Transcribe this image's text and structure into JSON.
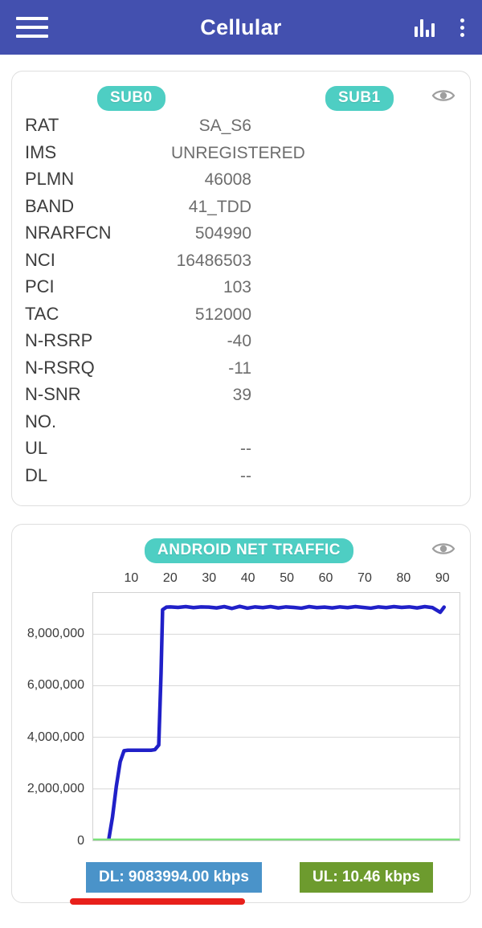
{
  "appbar": {
    "title": "Cellular",
    "menu_icon": "hamburger-menu-icon",
    "chart_icon": "bar-chart-icon",
    "overflow_icon": "more-vertical-icon"
  },
  "info_card": {
    "sub0_label": "SUB0",
    "sub1_label": "SUB1",
    "eye_icon": "eye-icon",
    "rows": [
      {
        "key": "RAT",
        "value": "SA_S6"
      },
      {
        "key": "IMS",
        "value": "UNREGISTERED"
      },
      {
        "key": "PLMN",
        "value": "46008"
      },
      {
        "key": "BAND",
        "value": "41_TDD"
      },
      {
        "key": "NRARFCN",
        "value": "504990"
      },
      {
        "key": "NCI",
        "value": "16486503"
      },
      {
        "key": "PCI",
        "value": "103"
      },
      {
        "key": "TAC",
        "value": "512000"
      },
      {
        "key": "N-RSRP",
        "value": "-40"
      },
      {
        "key": "N-RSRQ",
        "value": "-11"
      },
      {
        "key": "N-SNR",
        "value": "39"
      },
      {
        "key": "NO.",
        "value": ""
      },
      {
        "key": "UL",
        "value": "--"
      },
      {
        "key": "DL",
        "value": "--"
      }
    ]
  },
  "chart_card": {
    "title": "ANDROID NET TRAFFIC",
    "eye_icon": "eye-icon",
    "dl_label": "DL: 9083994.00 kbps",
    "ul_label": "UL: 10.46 kbps"
  },
  "colors": {
    "appbar": "#4350af",
    "badge_teal": "#4ecec3",
    "dl_blue": "#4a93c9",
    "ul_green": "#6d9b2e",
    "line_download": "#2020c8",
    "line_upload": "#7ae07a",
    "annotation_red": "#e8201b"
  },
  "chart_data": {
    "type": "line",
    "title": "ANDROID NET TRAFFIC",
    "xlabel": "",
    "ylabel": "",
    "xlim": [
      0,
      95
    ],
    "ylim": [
      0,
      9600000
    ],
    "grid": true,
    "legend": "none",
    "xticks": [
      10,
      20,
      30,
      40,
      50,
      60,
      70,
      80,
      90
    ],
    "yticks": [
      0,
      2000000,
      4000000,
      6000000,
      8000000
    ],
    "ytick_labels": [
      "0",
      "2,000,000",
      "4,000,000",
      "6,000,000",
      "8,000,000"
    ],
    "xtick_position": "top",
    "series": [
      {
        "name": "Download",
        "color": "#2020c8",
        "x": [
          4,
          5,
          6,
          7,
          8,
          9,
          10,
          11,
          12,
          13,
          14,
          15,
          16,
          17,
          17.6,
          18,
          19,
          20,
          22,
          24,
          26,
          28,
          30,
          32,
          34,
          36,
          38,
          40,
          42,
          44,
          46,
          48,
          50,
          52,
          54,
          56,
          58,
          60,
          62,
          64,
          66,
          68,
          70,
          72,
          74,
          76,
          78,
          80,
          82,
          84,
          86,
          88,
          90,
          91
        ],
        "y": [
          0,
          900000,
          2100000,
          3050000,
          3480000,
          3500000,
          3500000,
          3500000,
          3500000,
          3500000,
          3500000,
          3500000,
          3520000,
          3700000,
          6500000,
          8950000,
          9050000,
          9060000,
          9040000,
          9070000,
          9030000,
          9060000,
          9050000,
          9020000,
          9070000,
          9000000,
          9080000,
          9010000,
          9060000,
          9030000,
          9070000,
          9020000,
          9060000,
          9040000,
          9010000,
          9070000,
          9030000,
          9050000,
          9020000,
          9060000,
          9030000,
          9070000,
          9040000,
          9010000,
          9060000,
          9030000,
          9070000,
          9040000,
          9060000,
          9020000,
          9070000,
          9030000,
          8850000,
          9050000
        ]
      },
      {
        "name": "Upload",
        "color": "#7ae07a",
        "x": [
          0,
          95
        ],
        "y": [
          10460,
          10460
        ]
      }
    ]
  }
}
